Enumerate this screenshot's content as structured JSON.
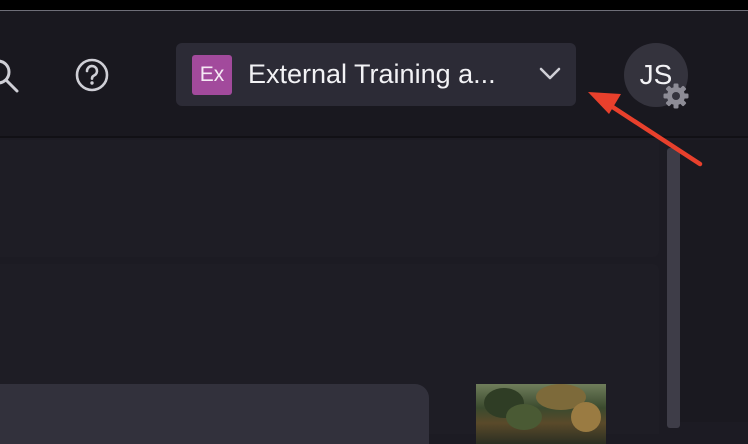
{
  "workspace": {
    "initials": "Ex",
    "name": "External Training a...",
    "avatar_color": "#a24a9c"
  },
  "user": {
    "initials": "JS"
  },
  "icons": {
    "search": "search-icon",
    "help": "help-circle-icon",
    "chevron": "chevron-down-icon",
    "settings": "gear-icon"
  },
  "colors": {
    "annotation_arrow": "#e8402c",
    "topbar_bg": "#19181f",
    "selector_bg": "#2c2b36"
  }
}
